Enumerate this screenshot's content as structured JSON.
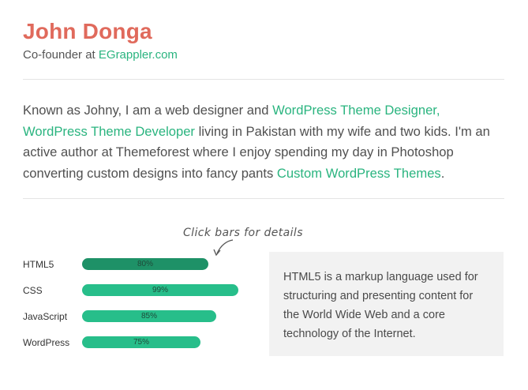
{
  "profile": {
    "name": "John Donga",
    "subtitle_prefix": "Co-founder at ",
    "subtitle_link": "EGrappler.com"
  },
  "bio": {
    "t1": "Known as Johny, I am a web designer and ",
    "l1": "WordPress Theme Designer, WordPress Theme Developer",
    "t2": " living in Pakistan with my wife and two kids. I'm an active author at Themeforest where I enjoy spending my day in Photoshop converting custom designs into fancy pants ",
    "l2": "Custom WordPress Themes",
    "t3": "."
  },
  "skills_hint": "Click bars for details",
  "skills": [
    {
      "name": "HTML5",
      "percent": 80,
      "label": "80%",
      "active": true
    },
    {
      "name": "CSS",
      "percent": 99,
      "label": "99%",
      "active": false
    },
    {
      "name": "JavaScript",
      "percent": 85,
      "label": "85%",
      "active": false
    },
    {
      "name": "WordPress",
      "percent": 75,
      "label": "75%",
      "active": false
    }
  ],
  "description": "HTML5 is a markup language used for structuring and presenting content for the World Wide Web and a core technology of the Internet.",
  "colors": {
    "name": "#e06a5c",
    "link": "#2ab47f",
    "bar": "#27be8a",
    "bar_active": "#1e9167",
    "box": "#f2f2f2"
  }
}
